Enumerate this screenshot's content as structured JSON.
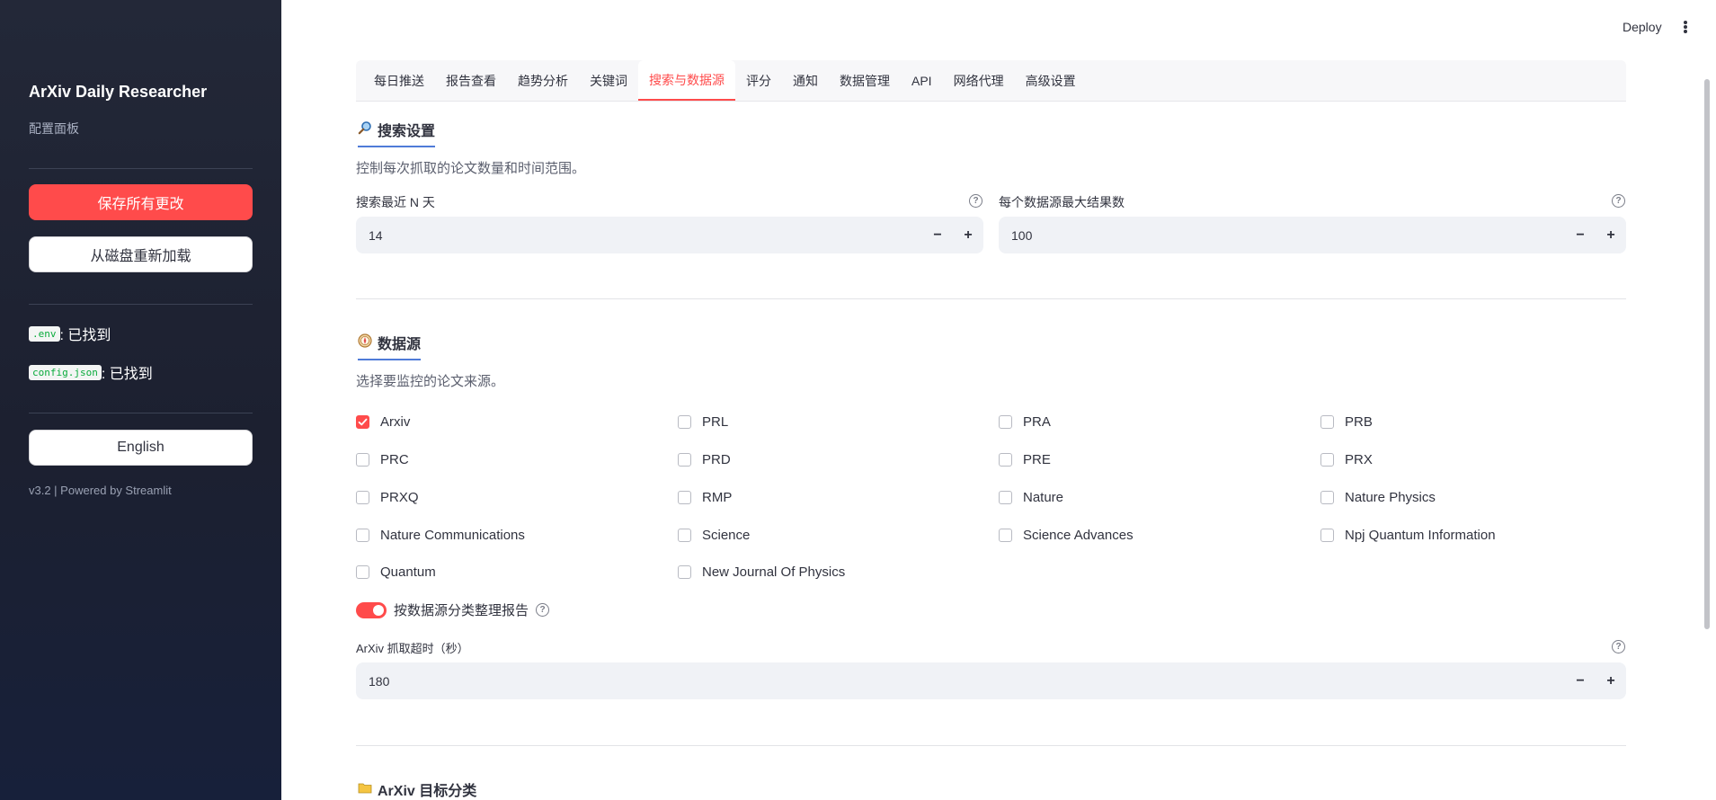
{
  "sidebar": {
    "title": "ArXiv Daily Researcher",
    "subtitle": "配置面板",
    "save_label": "保存所有更改",
    "reload_label": "从磁盘重新加载",
    "env_file": ".env",
    "env_status": ": 已找到",
    "config_file": "config.json",
    "config_status": ": 已找到",
    "language_label": "English",
    "version": "v3.2 | Powered by Streamlit"
  },
  "topbar": {
    "deploy_label": "Deploy"
  },
  "tabs": [
    {
      "label": "每日推送"
    },
    {
      "label": "报告查看"
    },
    {
      "label": "趋势分析"
    },
    {
      "label": "关键词"
    },
    {
      "label": "搜索与数据源"
    },
    {
      "label": "评分"
    },
    {
      "label": "通知"
    },
    {
      "label": "数据管理"
    },
    {
      "label": "API"
    },
    {
      "label": "网络代理"
    },
    {
      "label": "高级设置"
    }
  ],
  "active_tab": "搜索与数据源",
  "search": {
    "title": "搜索设置",
    "description": "控制每次抓取的论文数量和时间范围。",
    "days_label": "搜索最近 N 天",
    "days_value": "14",
    "max_results_label": "每个数据源最大结果数",
    "max_results_value": "100"
  },
  "sources": {
    "title": "数据源",
    "description": "选择要监控的论文来源。",
    "items": [
      {
        "label": "Arxiv",
        "checked": true
      },
      {
        "label": "PRL",
        "checked": false
      },
      {
        "label": "PRA",
        "checked": false
      },
      {
        "label": "PRB",
        "checked": false
      },
      {
        "label": "PRC",
        "checked": false
      },
      {
        "label": "PRD",
        "checked": false
      },
      {
        "label": "PRE",
        "checked": false
      },
      {
        "label": "PRX",
        "checked": false
      },
      {
        "label": "PRXQ",
        "checked": false
      },
      {
        "label": "RMP",
        "checked": false
      },
      {
        "label": "Nature",
        "checked": false
      },
      {
        "label": "Nature Physics",
        "checked": false
      },
      {
        "label": "Nature Communications",
        "checked": false
      },
      {
        "label": "Science",
        "checked": false
      },
      {
        "label": "Science Advances",
        "checked": false
      },
      {
        "label": "Npj Quantum Information",
        "checked": false
      },
      {
        "label": "Quantum",
        "checked": false
      },
      {
        "label": "New Journal Of Physics",
        "checked": false
      }
    ],
    "group_toggle_label": "按数据源分类整理报告",
    "group_toggle_on": true,
    "timeout_label": "ArXiv 抓取超时（秒）",
    "timeout_value": "180"
  },
  "categories": {
    "title": "ArXiv 目标分类"
  },
  "colors": {
    "accent": "#ff4b4b",
    "sidebar_bg": "#1c2030",
    "heading_underline": "#4f7bd8"
  },
  "icons": {
    "search_section": "magnifier-icon",
    "sources_section": "compass-icon",
    "categories_section": "folder-icon"
  }
}
